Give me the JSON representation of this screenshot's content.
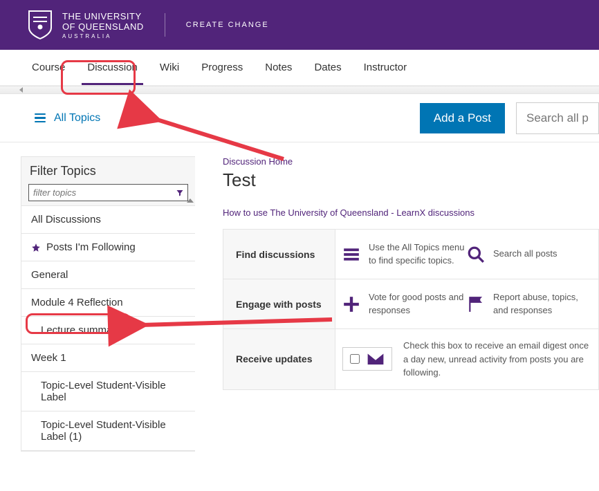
{
  "header": {
    "uni_line1": "THE UNIVERSITY",
    "uni_line2": "OF QUEENSLAND",
    "uni_line3": "AUSTRALIA",
    "tagline": "CREATE CHANGE"
  },
  "tabs": {
    "items": [
      {
        "label": "Course"
      },
      {
        "label": "Discussion"
      },
      {
        "label": "Wiki"
      },
      {
        "label": "Progress"
      },
      {
        "label": "Notes"
      },
      {
        "label": "Dates"
      },
      {
        "label": "Instructor"
      }
    ],
    "active_index": 1
  },
  "topbar": {
    "all_topics": "All Topics",
    "add_post": "Add a Post",
    "search_placeholder": "Search all posts"
  },
  "sidebar": {
    "title": "Filter Topics",
    "filter_placeholder": "filter topics",
    "topics": [
      {
        "label": "All Discussions",
        "indent": false,
        "icon": null
      },
      {
        "label": "Posts I'm Following",
        "indent": false,
        "icon": "star"
      },
      {
        "label": "General",
        "indent": false,
        "icon": null
      },
      {
        "label": "Module 4 Reflection",
        "indent": false,
        "icon": null
      },
      {
        "label": "Lecture summary",
        "indent": true,
        "icon": null
      },
      {
        "label": "Week 1",
        "indent": false,
        "icon": null
      },
      {
        "label": "Topic-Level Student-Visible Label",
        "indent": true,
        "icon": null
      },
      {
        "label": "Topic-Level Student-Visible Label (1)",
        "indent": true,
        "icon": null
      }
    ]
  },
  "main": {
    "crumb": "Discussion Home",
    "title": "Test",
    "howto": "How to use The University of Queensland - LearnX discussions",
    "rows": {
      "row1": {
        "label": "Find discussions",
        "item1": "Use the All Topics menu to find specific topics.",
        "item2": "Search all posts"
      },
      "row2": {
        "label": "Engage with posts",
        "item1": "Vote for good posts and responses",
        "item2": "Report abuse, topics, and responses"
      },
      "row3": {
        "label": "Receive updates",
        "text": "Check this box to receive an email digest once a day new, unread activity from posts you are following."
      }
    }
  }
}
